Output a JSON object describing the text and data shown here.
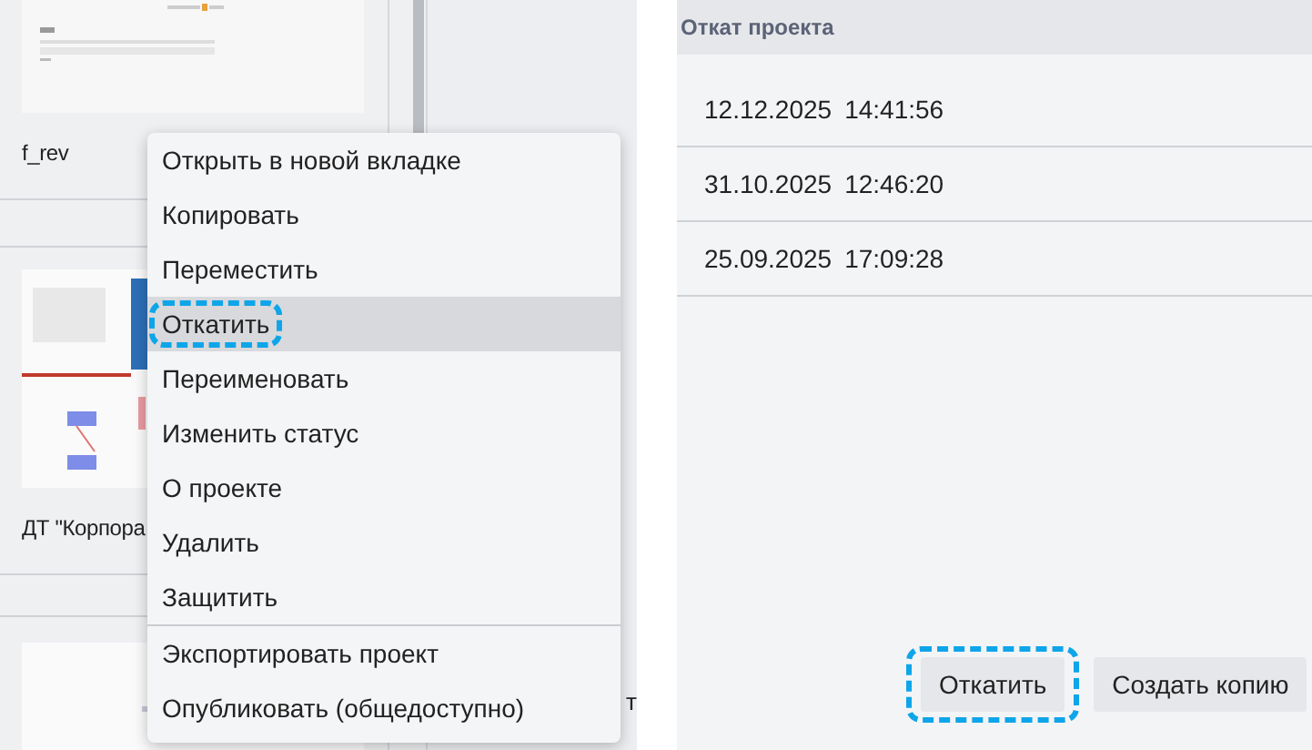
{
  "projects": [
    {
      "label": "f_rev",
      "kind": "form"
    },
    {
      "label": "ДТ \"Корпора",
      "kind": "slides"
    },
    {
      "kind": "chart"
    }
  ],
  "side_project": {
    "label": "т"
  },
  "context_menu": {
    "items": [
      {
        "label": "Открыть в новой вкладке",
        "selected": false,
        "highlighted": false,
        "divider_before": false
      },
      {
        "label": "Копировать",
        "selected": false,
        "highlighted": false,
        "divider_before": false
      },
      {
        "label": "Переместить",
        "selected": false,
        "highlighted": false,
        "divider_before": false
      },
      {
        "label": "Откатить",
        "selected": true,
        "highlighted": true,
        "divider_before": false
      },
      {
        "label": "Переименовать",
        "selected": false,
        "highlighted": false,
        "divider_before": false
      },
      {
        "label": "Изменить статус",
        "selected": false,
        "highlighted": false,
        "divider_before": false
      },
      {
        "label": "О проекте",
        "selected": false,
        "highlighted": false,
        "divider_before": false
      },
      {
        "label": "Удалить",
        "selected": false,
        "highlighted": false,
        "divider_before": false
      },
      {
        "label": "Защитить",
        "selected": false,
        "highlighted": false,
        "divider_before": false
      },
      {
        "label": "Экспортировать проект",
        "selected": false,
        "highlighted": false,
        "divider_before": true
      },
      {
        "label": "Опубликовать (общедоступно)",
        "selected": false,
        "highlighted": false,
        "divider_before": false
      }
    ]
  },
  "rollback_panel": {
    "title": "Откат проекта",
    "versions": [
      {
        "date": "12.12.2025",
        "time": "14:41:56"
      },
      {
        "date": "31.10.2025",
        "time": "12:46:20"
      },
      {
        "date": "25.09.2025",
        "time": "17:09:28"
      }
    ],
    "buttons": [
      {
        "label": "Откатить",
        "highlighted": true
      },
      {
        "label": "Создать копию",
        "highlighted": false
      }
    ]
  }
}
